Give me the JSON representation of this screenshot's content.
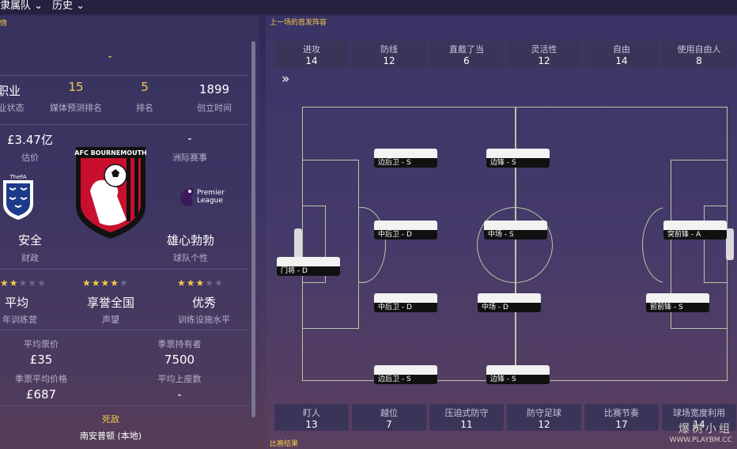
{
  "topbar": {
    "tab1": "隶属队 ⌄",
    "tab2": "历史 ⌄"
  },
  "left": {
    "header": "情",
    "dash": "-",
    "row1": [
      {
        "value": "职业",
        "label": "业状态"
      },
      {
        "value": "15",
        "label": "媒体预测排名"
      },
      {
        "value": "5",
        "label": "排名"
      },
      {
        "value": "1899",
        "label": "创立时间"
      }
    ],
    "valuation": {
      "value": "£3.47亿",
      "label": "估价"
    },
    "continental": {
      "value": "-",
      "label": "洲际赛事"
    },
    "club_crest_text": "AFC BOURNEMOUTH",
    "fa_text": "TheFA",
    "league_text": "Premier League",
    "finance": {
      "value": "安全",
      "label": "财政"
    },
    "personality": {
      "value": "雄心勃勃",
      "label": "球队个性"
    },
    "youth": {
      "value": "平均",
      "label": "年训练营",
      "stars": 1.5
    },
    "reputation": {
      "value": "享誉全国",
      "label": "声望",
      "stars": 3.5
    },
    "facilities": {
      "value": "优秀",
      "label": "训练设施水平",
      "stars": 3
    },
    "ticket": {
      "label": "平均票价",
      "value": "£35"
    },
    "season_holders": {
      "label": "季票持有者",
      "value": "7500"
    },
    "season_price": {
      "label": "季票平均价格",
      "value": "£687"
    },
    "attendance": {
      "label": "平均上座数",
      "value": "-"
    },
    "rival": {
      "label": "死敌",
      "value": "南安普顿 (本地)"
    }
  },
  "right": {
    "header": "上一场的首发阵容",
    "footer": "比赛结果",
    "expand": "»",
    "top_stats": [
      {
        "label": "进攻",
        "value": "14"
      },
      {
        "label": "防线",
        "value": "12"
      },
      {
        "label": "直截了当",
        "value": "6"
      },
      {
        "label": "灵活性",
        "value": "12"
      },
      {
        "label": "自由",
        "value": "14"
      },
      {
        "label": "使用自由人",
        "value": "8"
      }
    ],
    "bottom_stats": [
      {
        "label": "盯人",
        "value": "13"
      },
      {
        "label": "越位",
        "value": "7"
      },
      {
        "label": "压迫式防守",
        "value": "11"
      },
      {
        "label": "防守足球",
        "value": "12"
      },
      {
        "label": "比赛节奏",
        "value": "17"
      },
      {
        "label": "球场宽度利用",
        "value": "14"
      }
    ],
    "positions": [
      "门将 - D",
      "边后卫 - S",
      "中后卫 - D",
      "中后卫 - D",
      "边后卫 - S",
      "边锋 - S",
      "中场 - S",
      "中场 - D",
      "边锋 - S",
      "突前锋 - A",
      "前前锋 - S"
    ]
  },
  "watermark": {
    "line1": "爆树小组",
    "line2": "WWW.PLAYBM.CC"
  },
  "colors": {
    "accent": "#f2c94c",
    "pitch_line": "#b8c6a8"
  }
}
